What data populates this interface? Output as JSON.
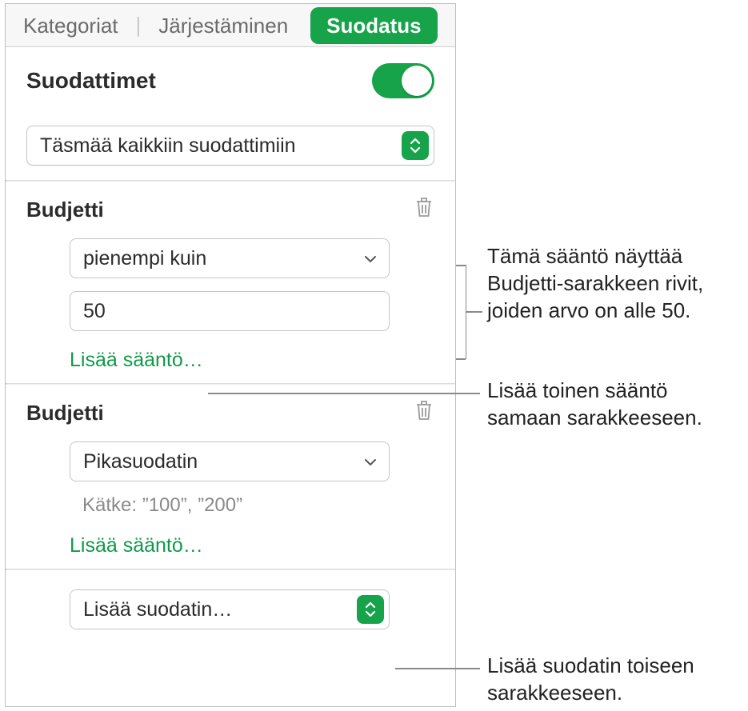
{
  "tabs": {
    "categories": "Kategoriat",
    "sort": "Järjestäminen",
    "filter": "Suodatus"
  },
  "filters": {
    "title": "Suodattimet",
    "match_all": "Täsmää kaikkiin suodattimiin"
  },
  "group1": {
    "title": "Budjetti",
    "operator": "pienempi kuin",
    "value": "50",
    "add_rule": "Lisää sääntö…"
  },
  "group2": {
    "title": "Budjetti",
    "operator": "Pikasuodatin",
    "hide_text": "Kätke: ”100”, ”200”",
    "add_rule": "Lisää sääntö…"
  },
  "add_filter": "Lisää suodatin…",
  "callouts": {
    "c1": "Tämä sääntö näyttää Budjetti-sarakkeen rivit, joiden arvo on alle 50.",
    "c2": "Lisää toinen sääntö samaan sarakkeeseen.",
    "c3": "Lisää suodatin toiseen sarakkeeseen."
  }
}
